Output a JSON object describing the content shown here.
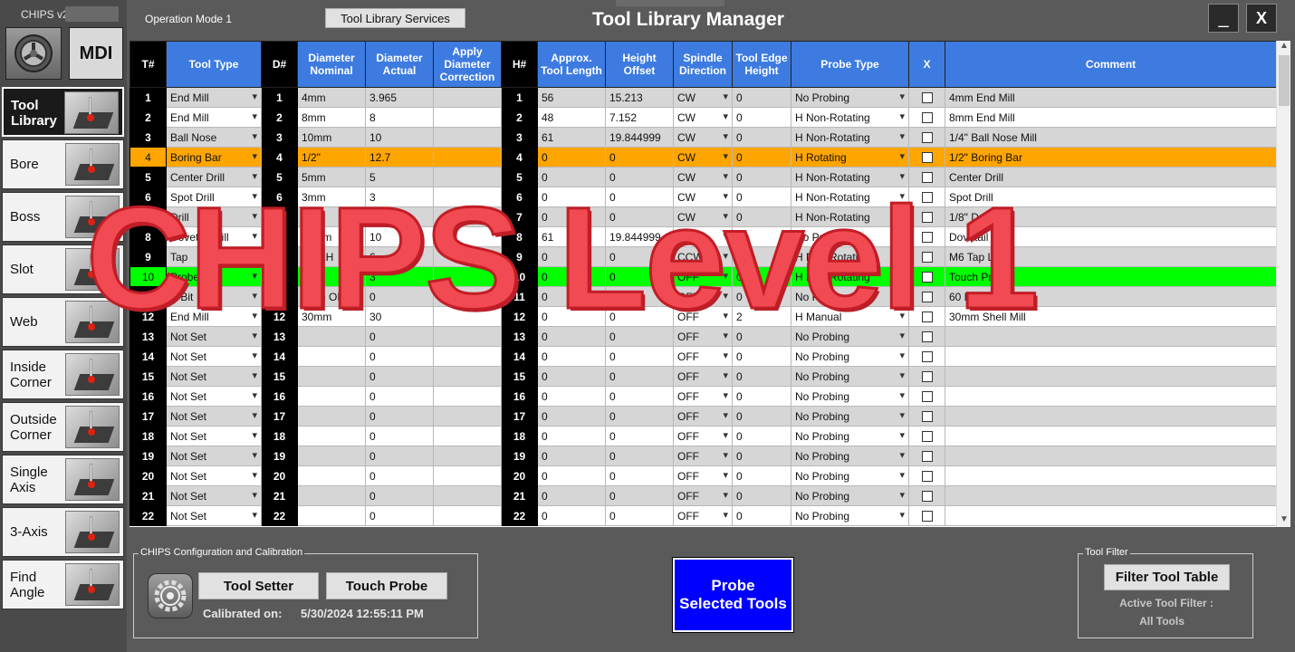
{
  "app": {
    "version": "CHIPS v2",
    "mdi_label": "MDI"
  },
  "header": {
    "operation_mode": "Operation Mode 1",
    "services_button": "Tool Library Services",
    "title": "Tool Library Manager",
    "minimize_glyph": "_",
    "close_glyph": "X"
  },
  "sidebar": {
    "items": [
      {
        "label": "Tool\nLibrary",
        "icon": "tool-library-icon",
        "active": true
      },
      {
        "label": "Bore",
        "icon": "bore-icon"
      },
      {
        "label": "Boss",
        "icon": "boss-icon"
      },
      {
        "label": "Slot",
        "icon": "slot-icon"
      },
      {
        "label": "Web",
        "icon": "web-icon"
      },
      {
        "label": "Inside\nCorner",
        "icon": "inside-corner-icon"
      },
      {
        "label": "Outside\nCorner",
        "icon": "outside-corner-icon"
      },
      {
        "label": "Single\nAxis",
        "icon": "single-axis-icon"
      },
      {
        "label": "3-Axis",
        "icon": "three-axis-icon"
      },
      {
        "label": "Find\nAngle",
        "icon": "find-angle-icon"
      }
    ]
  },
  "table": {
    "headers": {
      "t": "T#",
      "tool_type": "Tool Type",
      "d": "D#",
      "dia_nom": "Diameter Nominal",
      "dia_act": "Diameter Actual",
      "apply": "Apply Diameter Correction",
      "h": "H#",
      "len": "Approx. Tool Length",
      "offset": "Height Offset",
      "spindle": "Spindle Direction",
      "edge": "Tool Edge Height",
      "probe": "Probe Type",
      "x": "X",
      "comment": "Comment"
    },
    "rows": [
      {
        "t": "1",
        "type": "End Mill",
        "d": "1",
        "nom": "4mm",
        "act": "3.965",
        "h": "1",
        "len": "56",
        "off": "15.213",
        "dir": "CW",
        "edge": "0",
        "probe": "No Probing",
        "comment": "4mm End Mill",
        "style": "alt"
      },
      {
        "t": "2",
        "type": "End Mill",
        "d": "2",
        "nom": "8mm",
        "act": "8",
        "h": "2",
        "len": "48",
        "off": "7.152",
        "dir": "CW",
        "edge": "0",
        "probe": "H Non-Rotating",
        "comment": "8mm End Mill",
        "style": ""
      },
      {
        "t": "3",
        "type": "Ball Nose",
        "d": "3",
        "nom": "10mm",
        "act": "10",
        "h": "3",
        "len": "61",
        "off": "19.844999",
        "dir": "CW",
        "edge": "0",
        "probe": "H Non-Rotating",
        "comment": "1/4\" Ball Nose Mill",
        "style": "alt"
      },
      {
        "t": "4",
        "type": "Boring Bar",
        "d": "4",
        "nom": "1/2\"",
        "act": "12.7",
        "h": "4",
        "len": "0",
        "off": "0",
        "dir": "CW",
        "edge": "0",
        "probe": "H Rotating",
        "comment": "1/2\" Boring Bar",
        "style": "sel"
      },
      {
        "t": "5",
        "type": "Center Drill",
        "d": "5",
        "nom": "5mm",
        "act": "5",
        "h": "5",
        "len": "0",
        "off": "0",
        "dir": "CW",
        "edge": "0",
        "probe": "H Non-Rotating",
        "comment": "Center Drill",
        "style": "alt"
      },
      {
        "t": "6",
        "type": "Spot Drill",
        "d": "6",
        "nom": "3mm",
        "act": "3",
        "h": "6",
        "len": "0",
        "off": "0",
        "dir": "CW",
        "edge": "0",
        "probe": "H Non-Rotating",
        "comment": "Spot Drill",
        "style": ""
      },
      {
        "t": "7",
        "type": "Drill",
        "d": "7",
        "nom": "1/8\"",
        "act": "3.175",
        "h": "7",
        "len": "0",
        "off": "0",
        "dir": "CW",
        "edge": "0",
        "probe": "H Non-Rotating",
        "comment": "1/8\" Drill",
        "style": "alt"
      },
      {
        "t": "8",
        "type": "Dovetail Mill",
        "d": "8",
        "nom": "10mm",
        "act": "10",
        "h": "8",
        "len": "61",
        "off": "19.844999",
        "dir": "CW",
        "edge": "0",
        "probe": "No Probing",
        "comment": "Dovetail Mill",
        "style": ""
      },
      {
        "t": "9",
        "type": "Tap",
        "d": "9",
        "nom": "M6 LH",
        "act": "6",
        "h": "9",
        "len": "0",
        "off": "0",
        "dir": "CCW",
        "edge": "0",
        "probe": "H Non-Rotating",
        "comment": "M6 Tap Left",
        "style": "alt"
      },
      {
        "t": "10",
        "type": "Probe",
        "d": "10",
        "nom": "",
        "act": "3",
        "h": "10",
        "len": "0",
        "off": "0",
        "dir": "OFF",
        "edge": "0",
        "probe": "H Non-Rotating",
        "comment": "Touch Probe",
        "style": "probe"
      },
      {
        "t": "11",
        "type": "V-Bit",
        "d": "11",
        "nom": "5mm OD",
        "act": "0",
        "h": "11",
        "len": "0",
        "off": "0",
        "dir": "OFF",
        "edge": "0",
        "probe": "No Probing",
        "comment": "60 Degree V-Bit",
        "style": "alt"
      },
      {
        "t": "12",
        "type": "End Mill",
        "d": "12",
        "nom": "30mm",
        "act": "30",
        "h": "12",
        "len": "0",
        "off": "0",
        "dir": "OFF",
        "edge": "2",
        "probe": "H Manual",
        "comment": "30mm Shell Mill",
        "style": ""
      },
      {
        "t": "13",
        "type": "Not Set",
        "d": "13",
        "nom": "",
        "act": "0",
        "h": "13",
        "len": "0",
        "off": "0",
        "dir": "OFF",
        "edge": "0",
        "probe": "No Probing",
        "comment": "",
        "style": "alt"
      },
      {
        "t": "14",
        "type": "Not Set",
        "d": "14",
        "nom": "",
        "act": "0",
        "h": "14",
        "len": "0",
        "off": "0",
        "dir": "OFF",
        "edge": "0",
        "probe": "No Probing",
        "comment": "",
        "style": ""
      },
      {
        "t": "15",
        "type": "Not Set",
        "d": "15",
        "nom": "",
        "act": "0",
        "h": "15",
        "len": "0",
        "off": "0",
        "dir": "OFF",
        "edge": "0",
        "probe": "No Probing",
        "comment": "",
        "style": "alt"
      },
      {
        "t": "16",
        "type": "Not Set",
        "d": "16",
        "nom": "",
        "act": "0",
        "h": "16",
        "len": "0",
        "off": "0",
        "dir": "OFF",
        "edge": "0",
        "probe": "No Probing",
        "comment": "",
        "style": ""
      },
      {
        "t": "17",
        "type": "Not Set",
        "d": "17",
        "nom": "",
        "act": "0",
        "h": "17",
        "len": "0",
        "off": "0",
        "dir": "OFF",
        "edge": "0",
        "probe": "No Probing",
        "comment": "",
        "style": "alt"
      },
      {
        "t": "18",
        "type": "Not Set",
        "d": "18",
        "nom": "",
        "act": "0",
        "h": "18",
        "len": "0",
        "off": "0",
        "dir": "OFF",
        "edge": "0",
        "probe": "No Probing",
        "comment": "",
        "style": ""
      },
      {
        "t": "19",
        "type": "Not Set",
        "d": "19",
        "nom": "",
        "act": "0",
        "h": "19",
        "len": "0",
        "off": "0",
        "dir": "OFF",
        "edge": "0",
        "probe": "No Probing",
        "comment": "",
        "style": "alt"
      },
      {
        "t": "20",
        "type": "Not Set",
        "d": "20",
        "nom": "",
        "act": "0",
        "h": "20",
        "len": "0",
        "off": "0",
        "dir": "OFF",
        "edge": "0",
        "probe": "No Probing",
        "comment": "",
        "style": ""
      },
      {
        "t": "21",
        "type": "Not Set",
        "d": "21",
        "nom": "",
        "act": "0",
        "h": "21",
        "len": "0",
        "off": "0",
        "dir": "OFF",
        "edge": "0",
        "probe": "No Probing",
        "comment": "",
        "style": "alt"
      },
      {
        "t": "22",
        "type": "Not Set",
        "d": "22",
        "nom": "",
        "act": "0",
        "h": "22",
        "len": "0",
        "off": "0",
        "dir": "OFF",
        "edge": "0",
        "probe": "No Probing",
        "comment": "",
        "style": ""
      }
    ]
  },
  "watermark": "CHIPS Level 1",
  "config": {
    "group_label": "CHIPS Configuration and Calibration",
    "tool_setter": "Tool Setter",
    "touch_probe": "Touch Probe",
    "calibrated_label": "Calibrated on:",
    "calibrated_date": "5/30/2024 12:55:11 PM"
  },
  "probe_button": {
    "line1": "Probe",
    "line2": "Selected Tools"
  },
  "filter": {
    "group_label": "Tool Filter",
    "button": "Filter Tool Table",
    "active_label": "Active Tool Filter :",
    "active_value": "All Tools"
  },
  "colors": {
    "header_blue": "#3d7be0",
    "selected_row": "#ffa500",
    "probe_row": "#00ff00",
    "watermark": "#f24a52",
    "probe_button": "#0000ff"
  }
}
